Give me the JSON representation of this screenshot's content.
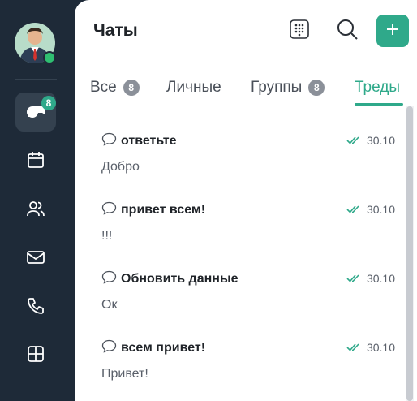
{
  "header": {
    "title": "Чаты"
  },
  "sidebar": {
    "avatar": "avatar",
    "items": [
      {
        "name": "chats",
        "icon": "chat-bubbles-icon",
        "badge": "8",
        "active": true
      },
      {
        "name": "calendar",
        "icon": "calendar-icon"
      },
      {
        "name": "contacts",
        "icon": "contacts-icon"
      },
      {
        "name": "mail",
        "icon": "mail-icon"
      },
      {
        "name": "calls",
        "icon": "phone-icon"
      },
      {
        "name": "apps",
        "icon": "apps-icon"
      }
    ]
  },
  "tabs": [
    {
      "label": "Все",
      "count": "8"
    },
    {
      "label": "Личные"
    },
    {
      "label": "Группы",
      "count": "8"
    },
    {
      "label": "Треды",
      "active": true
    }
  ],
  "threads": [
    {
      "title": "ответьте",
      "preview": "Добро",
      "date": "30.10"
    },
    {
      "title": "привет всем!",
      "preview": "!!!",
      "date": "30.10"
    },
    {
      "title": "Обновить данные",
      "preview": "Ок",
      "date": "30.10"
    },
    {
      "title": "всем привет!",
      "preview": "Привет!",
      "date": "30.10"
    }
  ],
  "colors": {
    "accent": "#2fa98a",
    "sidebar": "#1e2a38",
    "online": "#2fbf71"
  }
}
